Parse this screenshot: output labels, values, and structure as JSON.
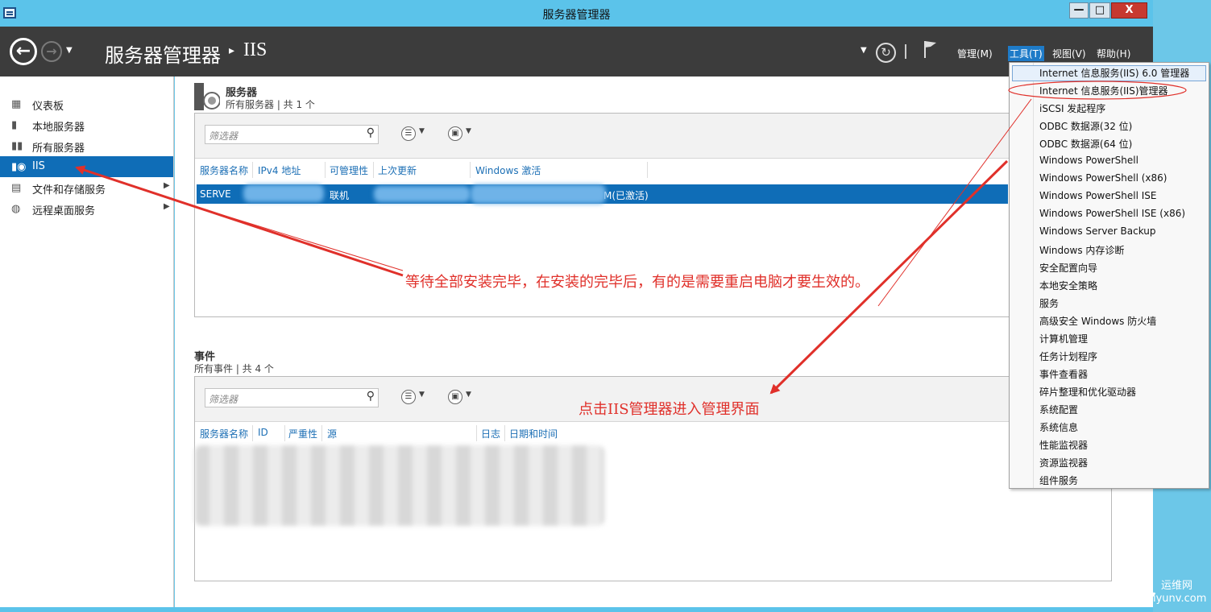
{
  "window": {
    "title": "服务器管理器",
    "minimize": "—",
    "maximize": "□",
    "close": "X"
  },
  "header": {
    "title": "服务器管理器",
    "separator": "▸",
    "page": "IIS",
    "menus": {
      "manage": "管理(M)",
      "tools": "工具(T)",
      "view": "视图(V)",
      "help": "帮助(H)"
    }
  },
  "sidebar": {
    "items": [
      {
        "label": "仪表板",
        "icon": "dashboard-icon"
      },
      {
        "label": "本地服务器",
        "icon": "server-icon"
      },
      {
        "label": "所有服务器",
        "icon": "servers-icon"
      },
      {
        "label": "IIS",
        "icon": "iis-icon",
        "active": true
      },
      {
        "label": "文件和存储服务",
        "icon": "storage-icon",
        "expandable": true
      },
      {
        "label": "远程桌面服务",
        "icon": "remote-desktop-icon",
        "expandable": true
      }
    ]
  },
  "servers_section": {
    "title": "服务器",
    "subtitle": "所有服务器 | 共 1 个",
    "filter_placeholder": "筛选器",
    "columns": [
      "服务器名称",
      "IPv4 地址",
      "可管理性",
      "上次更新",
      "Windows 激活"
    ],
    "row": {
      "name": "SERVE",
      "manageability": "联机",
      "activation": "M(已激活)"
    }
  },
  "events_section": {
    "title": "事件",
    "subtitle": "所有事件 | 共 4 个",
    "filter_placeholder": "筛选器",
    "columns": [
      "服务器名称",
      "ID",
      "严重性",
      "源",
      "日志",
      "日期和时间"
    ]
  },
  "tools_menu": {
    "items": [
      "Internet 信息服务(IIS) 6.0 管理器",
      "Internet 信息服务(IIS)管理器",
      "iSCSI 发起程序",
      "ODBC 数据源(32 位)",
      "ODBC 数据源(64 位)",
      "Windows PowerShell",
      "Windows PowerShell (x86)",
      "Windows PowerShell ISE",
      "Windows PowerShell ISE (x86)",
      "Windows Server Backup",
      "Windows 内存诊断",
      "安全配置向导",
      "本地安全策略",
      "服务",
      "高级安全 Windows 防火墙",
      "计算机管理",
      "任务计划程序",
      "事件查看器",
      "碎片整理和优化驱动器",
      "系统配置",
      "系统信息",
      "性能监视器",
      "资源监视器",
      "组件服务"
    ]
  },
  "annotations": {
    "note1": "等待全部安装完毕，在安装的完毕后，有的是需要重启电脑才要生效的。",
    "note2": "点击IIS管理器进入管理界面"
  },
  "watermark": {
    "top": "运维网",
    "bottom": "iyunv.com"
  },
  "colors": {
    "accent": "#0f6db7",
    "titlebar": "#5bc3ea",
    "header": "#3c3c3c",
    "annotation": "#e0302a"
  }
}
